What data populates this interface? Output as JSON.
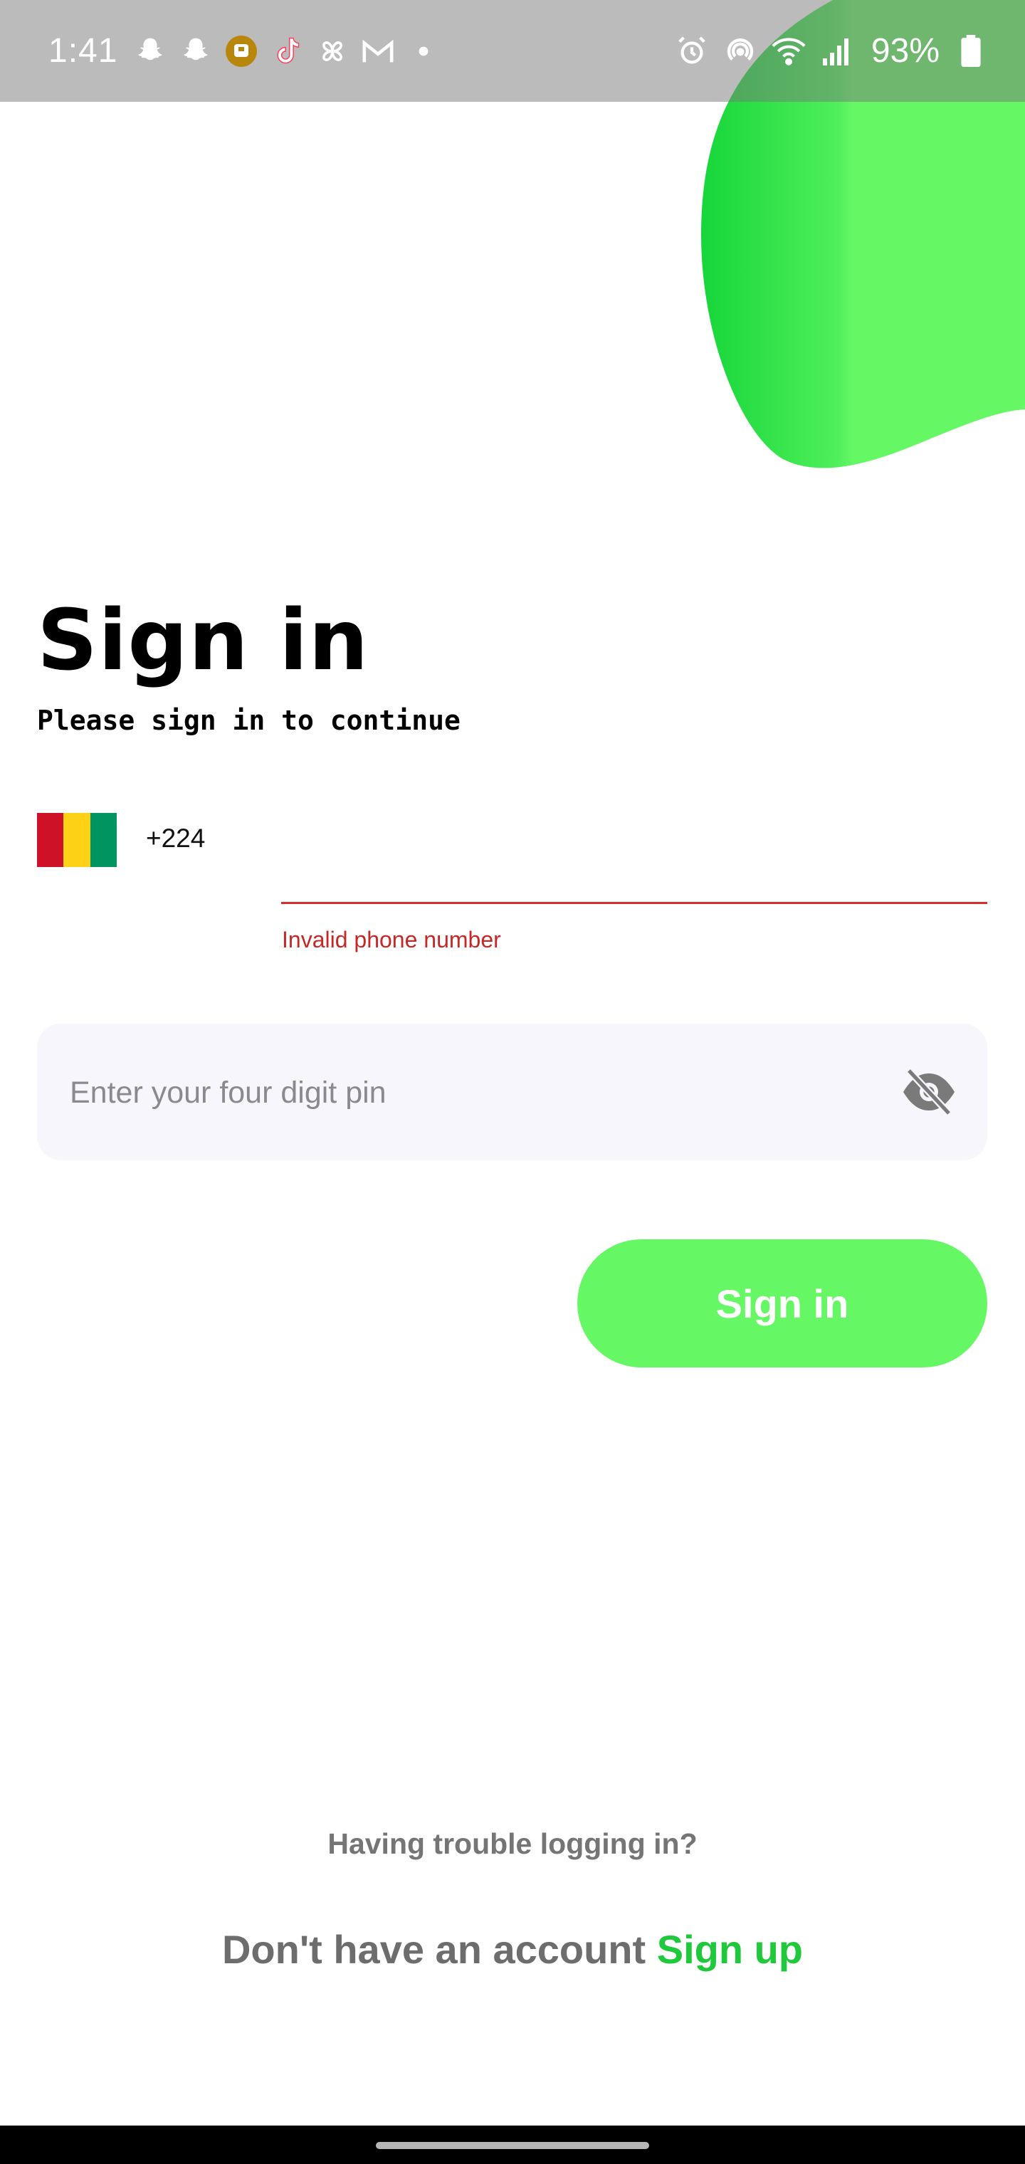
{
  "status_bar": {
    "time": "1:41",
    "battery_percent": "93%",
    "icons_left": [
      "snapchat-icon",
      "snapchat-icon",
      "notification-badge-icon",
      "tiktok-icon",
      "pinwheel-icon",
      "gmail-icon",
      "dot-icon"
    ],
    "icons_right": [
      "alarm-icon",
      "hotspot-icon",
      "wifi-icon",
      "signal-icon",
      "battery-icon"
    ]
  },
  "colors": {
    "accent_green": "#66f765",
    "link_green": "#1fc93b",
    "error_red": "#d32f2f",
    "field_bg": "#f6f6fc"
  },
  "heading": {
    "title": "Sign in",
    "subtitle": "Please sign in to continue"
  },
  "phone": {
    "country_flag": "guinea-flag",
    "flag_colors": [
      "#ce1126",
      "#fcd116",
      "#009460"
    ],
    "dial_code": "+224",
    "value": "",
    "error": "Invalid phone number"
  },
  "pin": {
    "value": "",
    "placeholder": "Enter your four digit pin",
    "visibility_icon": "eye-off-icon"
  },
  "actions": {
    "sign_in_label": "Sign in",
    "trouble_label": "Having trouble logging in?",
    "no_account_text": "Don't have an account",
    "sign_up_label": "Sign up"
  }
}
